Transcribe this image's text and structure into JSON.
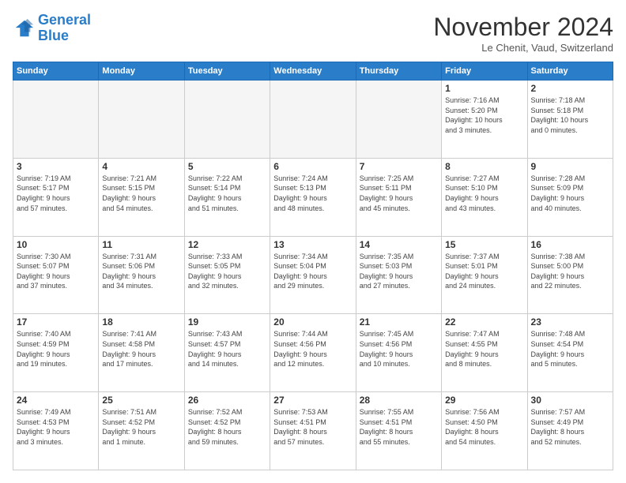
{
  "logo": {
    "line1": "General",
    "line2": "Blue"
  },
  "title": "November 2024",
  "location": "Le Chenit, Vaud, Switzerland",
  "weekdays": [
    "Sunday",
    "Monday",
    "Tuesday",
    "Wednesday",
    "Thursday",
    "Friday",
    "Saturday"
  ],
  "weeks": [
    [
      {
        "day": "",
        "info": ""
      },
      {
        "day": "",
        "info": ""
      },
      {
        "day": "",
        "info": ""
      },
      {
        "day": "",
        "info": ""
      },
      {
        "day": "",
        "info": ""
      },
      {
        "day": "1",
        "info": "Sunrise: 7:16 AM\nSunset: 5:20 PM\nDaylight: 10 hours\nand 3 minutes."
      },
      {
        "day": "2",
        "info": "Sunrise: 7:18 AM\nSunset: 5:18 PM\nDaylight: 10 hours\nand 0 minutes."
      }
    ],
    [
      {
        "day": "3",
        "info": "Sunrise: 7:19 AM\nSunset: 5:17 PM\nDaylight: 9 hours\nand 57 minutes."
      },
      {
        "day": "4",
        "info": "Sunrise: 7:21 AM\nSunset: 5:15 PM\nDaylight: 9 hours\nand 54 minutes."
      },
      {
        "day": "5",
        "info": "Sunrise: 7:22 AM\nSunset: 5:14 PM\nDaylight: 9 hours\nand 51 minutes."
      },
      {
        "day": "6",
        "info": "Sunrise: 7:24 AM\nSunset: 5:13 PM\nDaylight: 9 hours\nand 48 minutes."
      },
      {
        "day": "7",
        "info": "Sunrise: 7:25 AM\nSunset: 5:11 PM\nDaylight: 9 hours\nand 45 minutes."
      },
      {
        "day": "8",
        "info": "Sunrise: 7:27 AM\nSunset: 5:10 PM\nDaylight: 9 hours\nand 43 minutes."
      },
      {
        "day": "9",
        "info": "Sunrise: 7:28 AM\nSunset: 5:09 PM\nDaylight: 9 hours\nand 40 minutes."
      }
    ],
    [
      {
        "day": "10",
        "info": "Sunrise: 7:30 AM\nSunset: 5:07 PM\nDaylight: 9 hours\nand 37 minutes."
      },
      {
        "day": "11",
        "info": "Sunrise: 7:31 AM\nSunset: 5:06 PM\nDaylight: 9 hours\nand 34 minutes."
      },
      {
        "day": "12",
        "info": "Sunrise: 7:33 AM\nSunset: 5:05 PM\nDaylight: 9 hours\nand 32 minutes."
      },
      {
        "day": "13",
        "info": "Sunrise: 7:34 AM\nSunset: 5:04 PM\nDaylight: 9 hours\nand 29 minutes."
      },
      {
        "day": "14",
        "info": "Sunrise: 7:35 AM\nSunset: 5:03 PM\nDaylight: 9 hours\nand 27 minutes."
      },
      {
        "day": "15",
        "info": "Sunrise: 7:37 AM\nSunset: 5:01 PM\nDaylight: 9 hours\nand 24 minutes."
      },
      {
        "day": "16",
        "info": "Sunrise: 7:38 AM\nSunset: 5:00 PM\nDaylight: 9 hours\nand 22 minutes."
      }
    ],
    [
      {
        "day": "17",
        "info": "Sunrise: 7:40 AM\nSunset: 4:59 PM\nDaylight: 9 hours\nand 19 minutes."
      },
      {
        "day": "18",
        "info": "Sunrise: 7:41 AM\nSunset: 4:58 PM\nDaylight: 9 hours\nand 17 minutes."
      },
      {
        "day": "19",
        "info": "Sunrise: 7:43 AM\nSunset: 4:57 PM\nDaylight: 9 hours\nand 14 minutes."
      },
      {
        "day": "20",
        "info": "Sunrise: 7:44 AM\nSunset: 4:56 PM\nDaylight: 9 hours\nand 12 minutes."
      },
      {
        "day": "21",
        "info": "Sunrise: 7:45 AM\nSunset: 4:56 PM\nDaylight: 9 hours\nand 10 minutes."
      },
      {
        "day": "22",
        "info": "Sunrise: 7:47 AM\nSunset: 4:55 PM\nDaylight: 9 hours\nand 8 minutes."
      },
      {
        "day": "23",
        "info": "Sunrise: 7:48 AM\nSunset: 4:54 PM\nDaylight: 9 hours\nand 5 minutes."
      }
    ],
    [
      {
        "day": "24",
        "info": "Sunrise: 7:49 AM\nSunset: 4:53 PM\nDaylight: 9 hours\nand 3 minutes."
      },
      {
        "day": "25",
        "info": "Sunrise: 7:51 AM\nSunset: 4:52 PM\nDaylight: 9 hours\nand 1 minute."
      },
      {
        "day": "26",
        "info": "Sunrise: 7:52 AM\nSunset: 4:52 PM\nDaylight: 8 hours\nand 59 minutes."
      },
      {
        "day": "27",
        "info": "Sunrise: 7:53 AM\nSunset: 4:51 PM\nDaylight: 8 hours\nand 57 minutes."
      },
      {
        "day": "28",
        "info": "Sunrise: 7:55 AM\nSunset: 4:51 PM\nDaylight: 8 hours\nand 55 minutes."
      },
      {
        "day": "29",
        "info": "Sunrise: 7:56 AM\nSunset: 4:50 PM\nDaylight: 8 hours\nand 54 minutes."
      },
      {
        "day": "30",
        "info": "Sunrise: 7:57 AM\nSunset: 4:49 PM\nDaylight: 8 hours\nand 52 minutes."
      }
    ]
  ]
}
